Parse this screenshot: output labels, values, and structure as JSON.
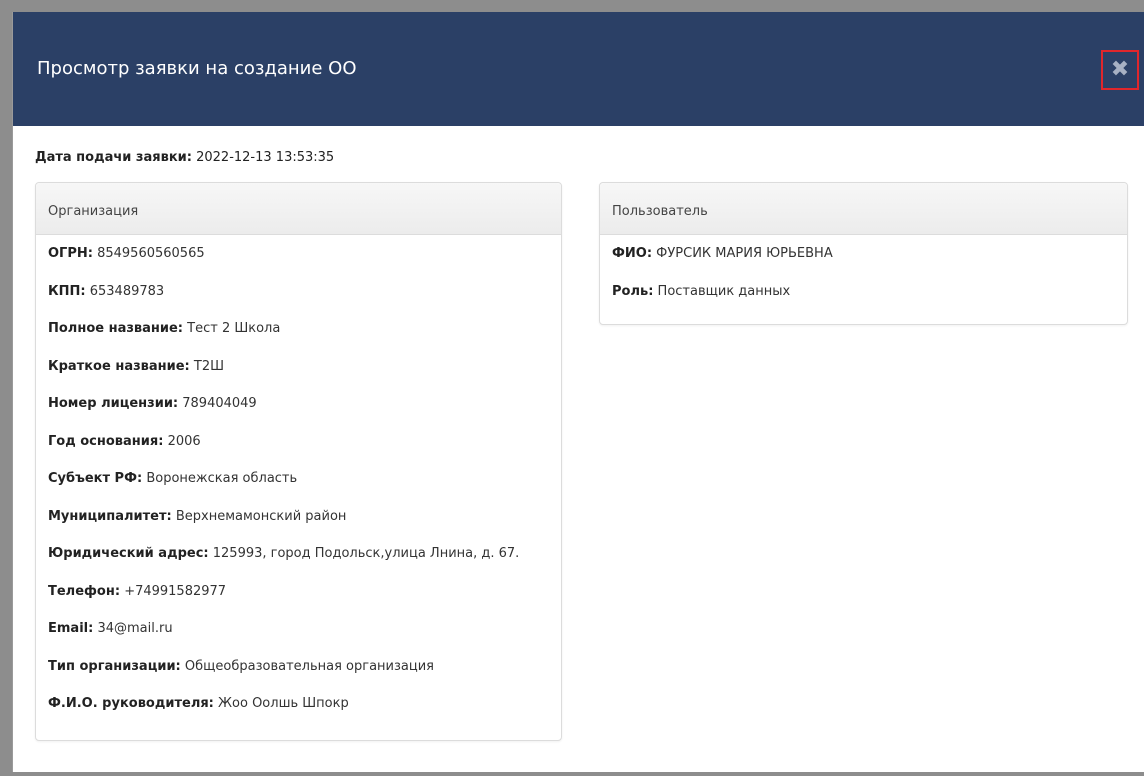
{
  "modal": {
    "title": "Просмотр заявки на создание ОО",
    "close_icon_glyph": "✖"
  },
  "submission": {
    "label": "Дата подачи заявки:",
    "value": "2022-12-13 13:53:35"
  },
  "organization": {
    "heading": "Организация",
    "fields": [
      {
        "label": "ОГРН:",
        "value": "8549560560565"
      },
      {
        "label": "КПП:",
        "value": "653489783"
      },
      {
        "label": "Полное название:",
        "value": "Тест 2 Школа"
      },
      {
        "label": "Краткое название:",
        "value": "Т2Ш"
      },
      {
        "label": "Номер лицензии:",
        "value": "789404049"
      },
      {
        "label": "Год основания:",
        "value": "2006"
      },
      {
        "label": "Субъект РФ:",
        "value": "Воронежская область"
      },
      {
        "label": "Муниципалитет:",
        "value": "Верхнемамонский район"
      },
      {
        "label": "Юридический адрес:",
        "value": "125993, город Подольск,улица Лнина, д. 67."
      },
      {
        "label": "Телефон:",
        "value": "+74991582977"
      },
      {
        "label": "Email:",
        "value": "34@mail.ru"
      },
      {
        "label": "Тип организации:",
        "value": "Общеобразовательная организация"
      },
      {
        "label": "Ф.И.О. руководителя:",
        "value": "Жоо Оолшь Шпокр"
      }
    ]
  },
  "user": {
    "heading": "Пользователь",
    "fields": [
      {
        "label": "ФИО:",
        "value": "ФУРСИК МАРИЯ ЮРЬЕВНА"
      },
      {
        "label": "Роль:",
        "value": "Поставщик данных"
      }
    ]
  },
  "colors": {
    "header_bg": "#2b4066",
    "close_highlight": "#e0262b"
  }
}
